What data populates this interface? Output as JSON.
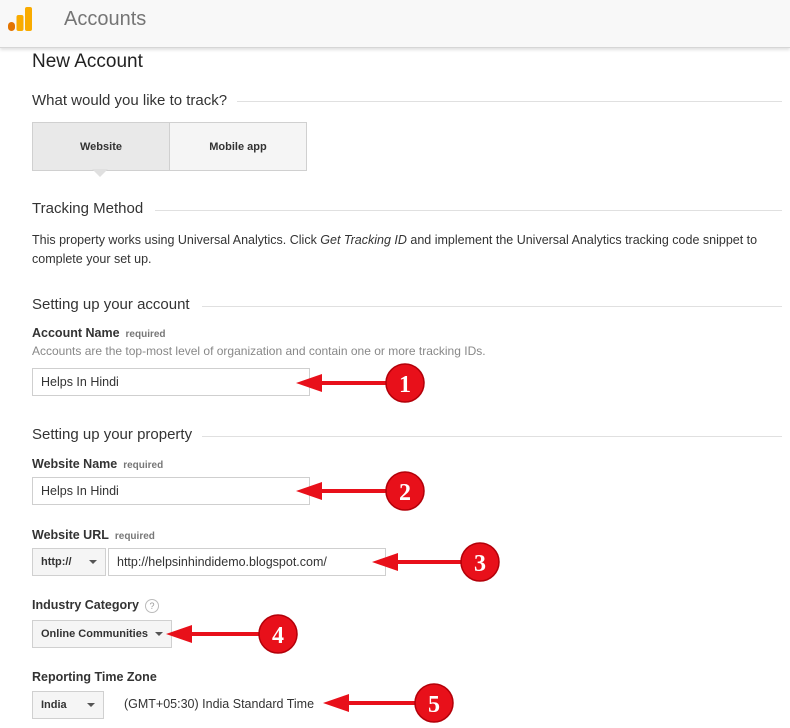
{
  "header": {
    "title": "Accounts"
  },
  "page": {
    "heading": "New Account",
    "track_question": "What would you like to track?",
    "tabs": [
      {
        "label": "Website",
        "active": true
      },
      {
        "label": "Mobile app",
        "active": false
      }
    ],
    "tracking_method": {
      "title": "Tracking Method",
      "text_before": "This property works using Universal Analytics. Click ",
      "link_text": "Get Tracking ID",
      "text_after": " and implement the Universal Analytics tracking code snippet to complete your set up."
    },
    "account_section": {
      "title": "Setting up your account",
      "account_name_label": "Account Name",
      "required": "required",
      "account_name_hint": "Accounts are the top-most level of organization and contain one or more tracking IDs.",
      "account_name_value": "Helps In Hindi"
    },
    "property_section": {
      "title": "Setting up your property",
      "website_name_label": "Website Name",
      "website_name_value": "Helps In Hindi",
      "website_url_label": "Website URL",
      "protocol": "http://",
      "website_url_value": "http://helpsinhindidemo.blogspot.com/",
      "industry_label": "Industry Category",
      "help_symbol": "?",
      "industry_value": "Online Communities",
      "timezone_label": "Reporting Time Zone",
      "timezone_country": "India",
      "timezone_value": "(GMT+05:30) India Standard Time"
    }
  },
  "annotations": [
    {
      "number": "1"
    },
    {
      "number": "2"
    },
    {
      "number": "3"
    },
    {
      "number": "4"
    },
    {
      "number": "5"
    }
  ],
  "colors": {
    "annotation": "#e8101a",
    "logo_orange": "#f9ab00",
    "logo_dark": "#e37400"
  }
}
